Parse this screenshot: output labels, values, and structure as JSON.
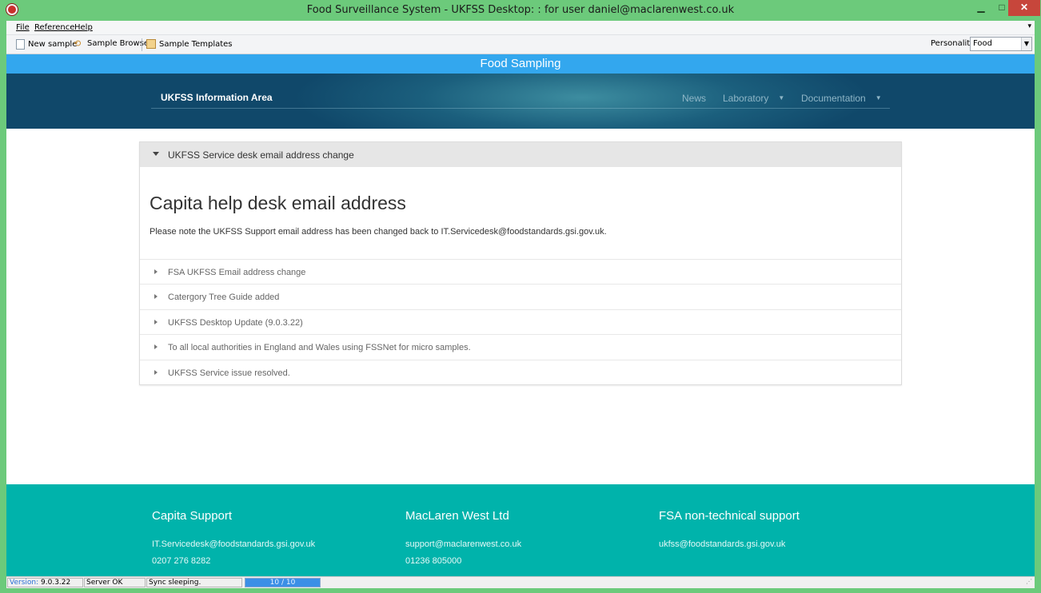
{
  "window": {
    "title": "Food Surveillance System - UKFSS Desktop: : for user daniel@maclarenwest.co.uk",
    "minimize_glyph": "▁",
    "maximize_glyph": "□",
    "close_glyph": "✕"
  },
  "menu": {
    "items": [
      "File",
      "Reference",
      "Help"
    ],
    "overflow_glyph": "▾"
  },
  "toolbar": {
    "new_sample": "New sample",
    "sample_browser": "Sample Browser",
    "sample_templates": "Sample Templates",
    "personality_label": "Personality",
    "personality_value": "Food"
  },
  "banner": {
    "title": "Food Sampling"
  },
  "hero": {
    "title": "UKFSS Information Area",
    "nav": [
      "News",
      "Laboratory",
      "Documentation"
    ]
  },
  "accordion": {
    "open_header": "UKFSS Service desk email address change",
    "article_title": "Capita help desk email address",
    "article_body": "Please note the UKFSS Support email address has been changed back to IT.Servicedesk@foodstandards.gsi.gov.uk.",
    "collapsed_items": [
      "FSA UKFSS Email address change",
      "Catergory Tree Guide added",
      "UKFSS Desktop Update (9.0.3.22)",
      "To all local authorities in England and Wales using FSSNet for micro samples.",
      "UKFSS Service issue resolved."
    ]
  },
  "footer": {
    "capita": {
      "heading": "Capita Support",
      "email": "IT.Servicedesk@foodstandards.gsi.gov.uk",
      "phone": "0207 276 8282"
    },
    "maclaren": {
      "heading": "MacLaren West Ltd",
      "email": "support@maclarenwest.co.uk",
      "phone": "01236 805000"
    },
    "fsa": {
      "heading": "FSA non-technical support",
      "email": "ukfss@foodstandards.gsi.gov.uk"
    }
  },
  "status": {
    "version_label": "Version:",
    "version_value": "9.0.3.22",
    "server": "Server OK",
    "sync": "Sync sleeping.",
    "progress_text": "10 / 10",
    "progress_fraction": 1.0
  }
}
